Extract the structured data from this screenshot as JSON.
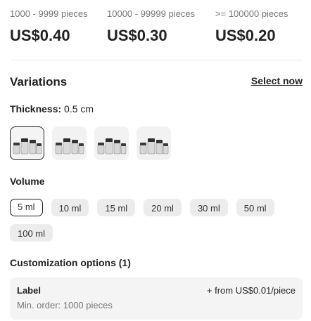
{
  "price_tiers": [
    {
      "range": "1000 - 9999 pieces",
      "price": "US$0.40"
    },
    {
      "range": "10000 - 99999 pieces",
      "price": "US$0.30"
    },
    {
      "range": ">= 100000 pieces",
      "price": "US$0.20"
    }
  ],
  "variations": {
    "title": "Variations",
    "select_now": "Select now",
    "thickness": {
      "label": "Thickness:",
      "value": "0.5 cm",
      "options_count": 4,
      "selected_index": 0
    },
    "volume": {
      "label": "Volume",
      "options": [
        "5 ml",
        "10 ml",
        "15 ml",
        "20 ml",
        "30 ml",
        "50 ml",
        "100 ml"
      ],
      "selected": "5 ml"
    }
  },
  "customization": {
    "title": "Customization options (1)",
    "options": [
      {
        "name": "Label",
        "price": "+ from US$0.01/piece",
        "min_order": "Min. order: 1000 pieces"
      }
    ]
  },
  "colors": {
    "text": "#222222",
    "muted": "#767676",
    "chip_bg": "#ececec",
    "box_bg": "#f4f4f4"
  }
}
